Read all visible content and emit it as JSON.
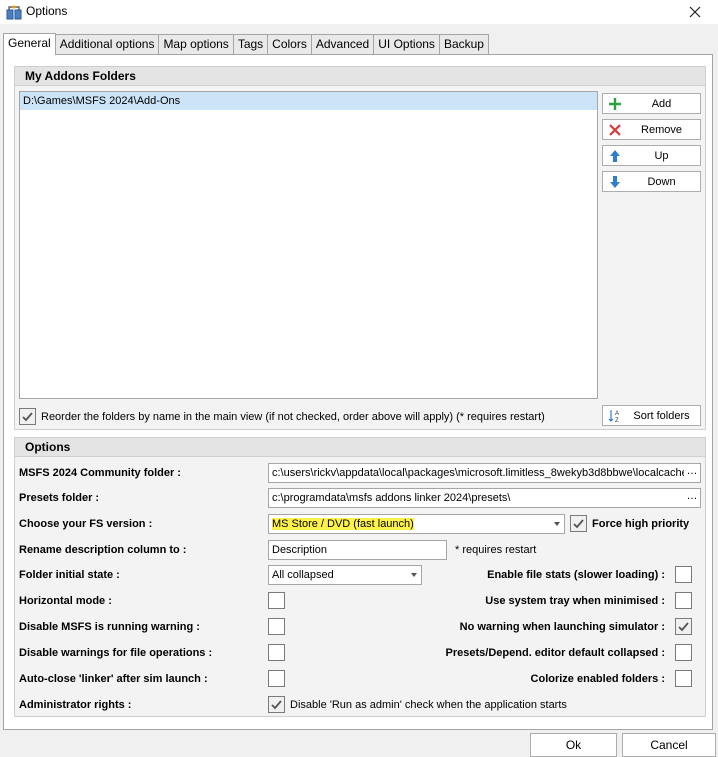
{
  "window": {
    "title": "Options"
  },
  "tabs": [
    "General",
    "Additional options",
    "Map options",
    "Tags",
    "Colors",
    "Advanced",
    "UI Options",
    "Backup"
  ],
  "addons": {
    "header": "My Addons Folders",
    "folders": [
      "D:\\Games\\MSFS 2024\\Add-Ons"
    ],
    "buttons": {
      "add": "Add",
      "remove": "Remove",
      "up": "Up",
      "down": "Down",
      "sort": "Sort folders"
    },
    "reorder_label": "Reorder the folders by name in the main view (if not checked, order above will apply) (* requires restart)",
    "reorder_checked": true
  },
  "options": {
    "header": "Options",
    "community_label": "MSFS 2024 Community folder :",
    "community_value": "c:\\users\\rickv\\appdata\\local\\packages\\microsoft.limitless_8wekyb3d8bbwe\\localcache",
    "presets_label": "Presets folder :",
    "presets_value": "c:\\programdata\\msfs addons linker 2024\\presets\\",
    "fs_version_label": "Choose your FS version :",
    "fs_version_value": "MS Store / DVD (fast launch)",
    "force_priority_label": "Force high priority",
    "force_priority_checked": true,
    "rename_label": "Rename description column to :",
    "rename_value": "Description",
    "rename_note": "* requires restart",
    "folder_state_label": "Folder initial state :",
    "folder_state_value": "All collapsed",
    "file_stats_label": "Enable file stats (slower loading) :",
    "horizontal_label": "Horizontal mode :",
    "tray_label": "Use system tray when minimised :",
    "msfs_warning_label": "Disable MSFS is running warning :",
    "no_warning_label": "No warning when launching simulator :",
    "no_warning_checked": true,
    "file_ops_label": "Disable warnings for file operations :",
    "presets_collapsed_label": "Presets/Depend. editor default collapsed :",
    "autoclose_label": "Auto-close 'linker' after sim launch :",
    "colorize_label": "Colorize enabled folders :",
    "admin_label": "Administrator rights :",
    "admin_check_label": "Disable 'Run as admin' check when the application starts",
    "admin_checked": true
  },
  "footer": {
    "ok": "Ok",
    "cancel": "Cancel"
  },
  "colors": {
    "highlight": "#fff34a",
    "selection": "#cce4f7"
  }
}
